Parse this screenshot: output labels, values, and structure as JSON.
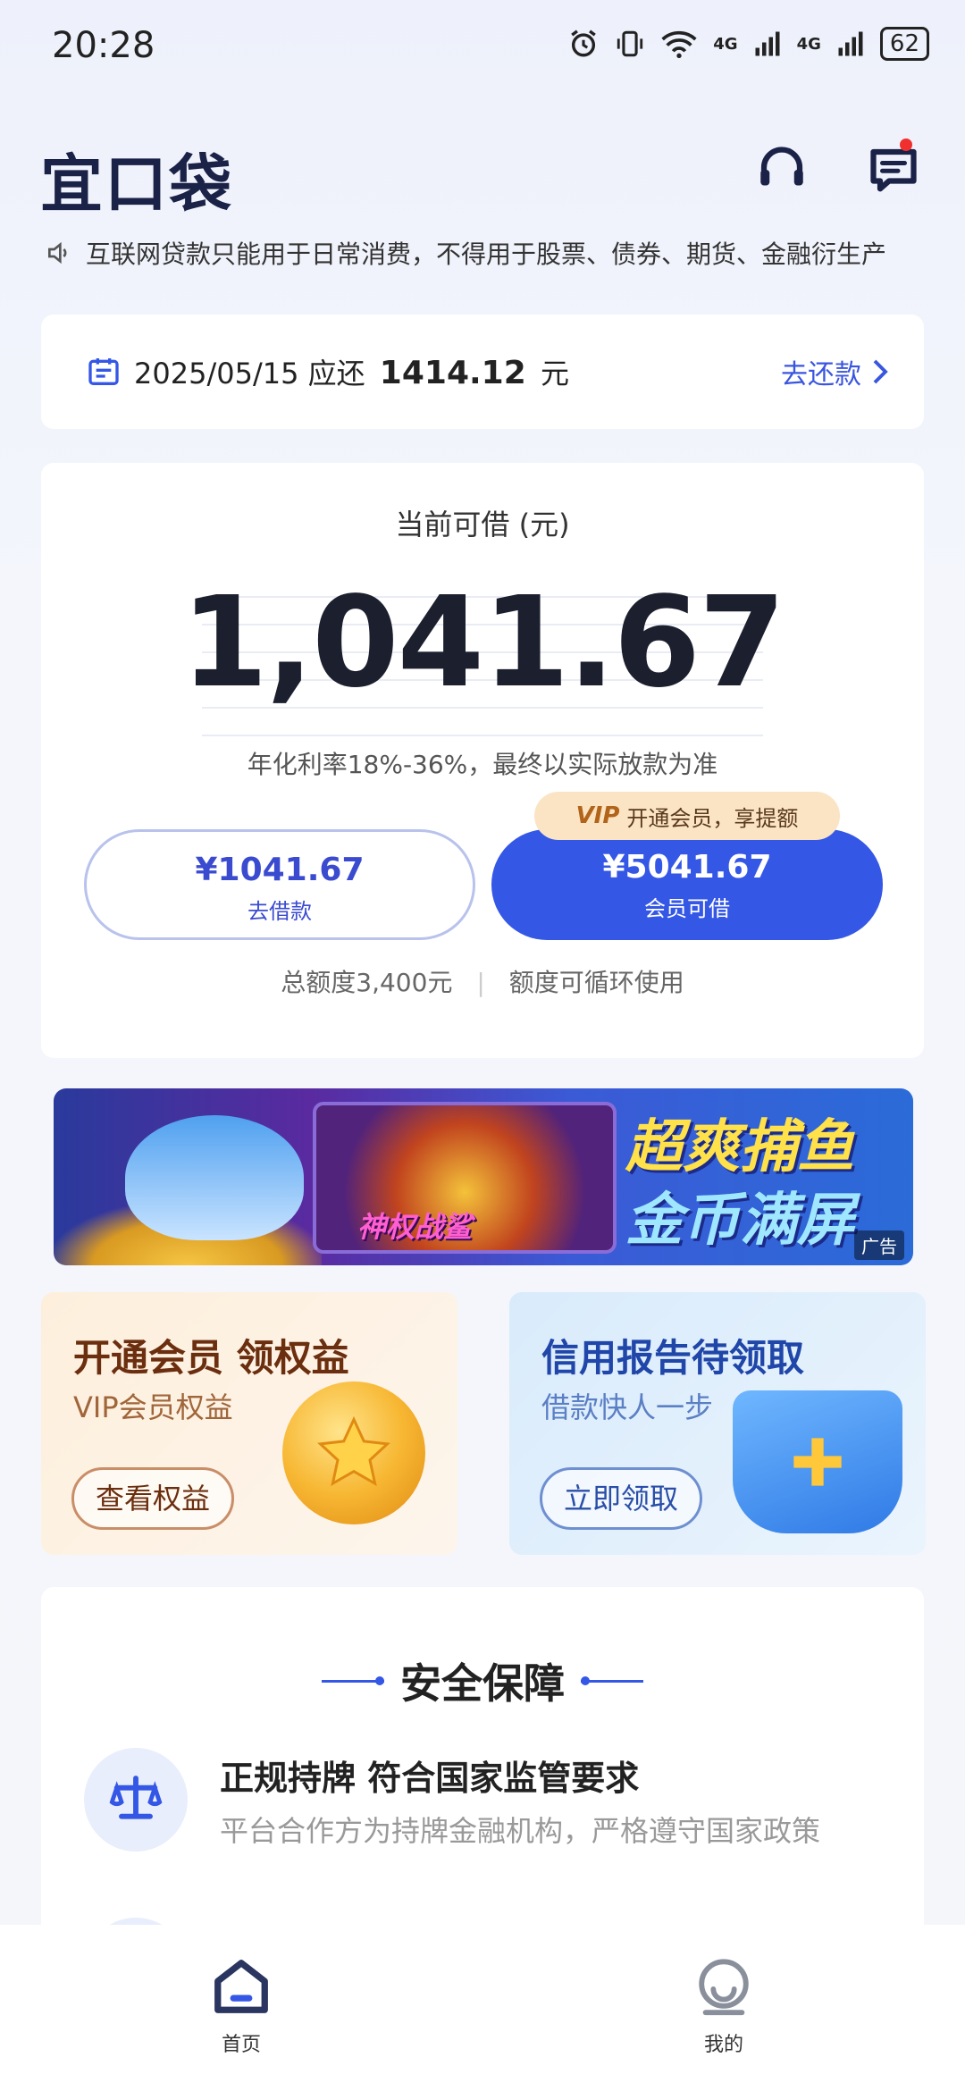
{
  "status_bar": {
    "time": "20:28",
    "network1": "4G",
    "network2": "4G",
    "battery": "62"
  },
  "header": {
    "logo": "宜口袋"
  },
  "notice": {
    "text": "互联网贷款只能用于日常消费，不得用于股票、债券、期货、金融衍生产"
  },
  "repay": {
    "date": "2025/05/15",
    "due_label": "应还",
    "amount": "1414.12",
    "unit": "元",
    "link": "去还款"
  },
  "credit": {
    "title": "当前可借 (元)",
    "amount": "1,041.67",
    "rate_note": "年化利率18%-36%，最终以实际放款为准",
    "borrow_btn": {
      "amount": "¥1041.67",
      "label": "去借款"
    },
    "member_btn": {
      "amount": "¥5041.67",
      "label": "会员可借"
    },
    "vip_tip": {
      "badge": "VIP",
      "text": "开通会员，享提额"
    },
    "quota_total": "总额度3,400元",
    "quota_note": "额度可循环使用"
  },
  "ad": {
    "title1": "超爽捕鱼",
    "title2": "金币满屏",
    "sub": "神权战鲨",
    "tag": "广告"
  },
  "promos": [
    {
      "title": "开通会员 领权益",
      "sub": "VIP会员权益",
      "button": "查看权益"
    },
    {
      "title": "信用报告待领取",
      "sub": "借款快人一步",
      "button": "立即领取"
    }
  ],
  "safety": {
    "title": "安全保障",
    "items": [
      {
        "title": "正规持牌 符合国家监管要求",
        "desc": "平台合作方为持牌金融机构，严格遵守国家政策"
      }
    ]
  },
  "bottom_nav": [
    {
      "label": "首页",
      "icon": "home-icon"
    },
    {
      "label": "我的",
      "icon": "profile-icon"
    }
  ],
  "colors": {
    "accent": "#3457e6",
    "notify_dot": "#f0302f"
  }
}
